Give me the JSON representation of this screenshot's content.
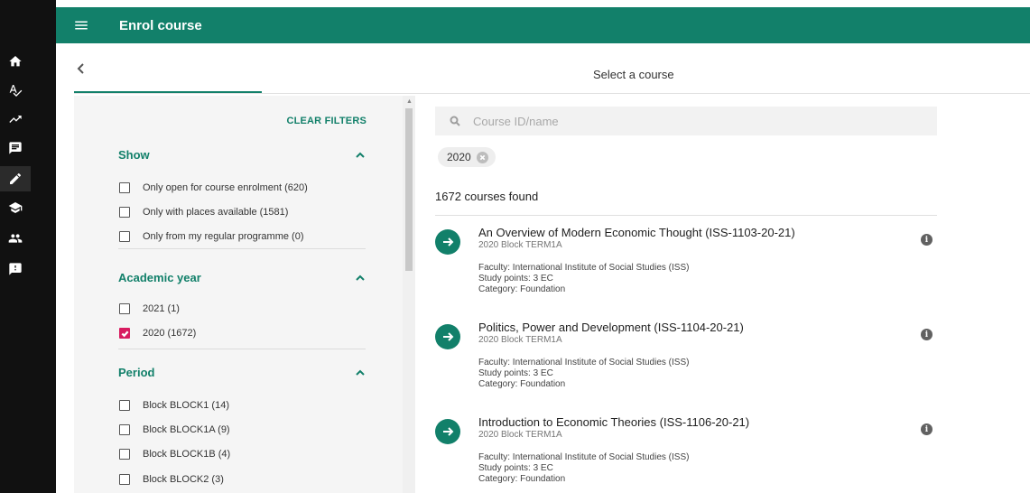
{
  "appbar": {
    "title": "Enrol course",
    "menu_icon": "menu-icon"
  },
  "rail": {
    "items": [
      {
        "icon": "home-icon"
      },
      {
        "icon": "spellcheck-icon"
      },
      {
        "icon": "trending-icon"
      },
      {
        "icon": "message-icon"
      },
      {
        "icon": "edit-icon",
        "active": true
      },
      {
        "icon": "school-icon"
      },
      {
        "icon": "group-icon"
      },
      {
        "icon": "feedback-icon"
      }
    ]
  },
  "subheader": {
    "title": "Select a course"
  },
  "filters": {
    "clear_label": "CLEAR FILTERS",
    "show": {
      "label": "Show",
      "options": [
        {
          "label": "Only open for course enrolment (620)",
          "checked": false
        },
        {
          "label": "Only with places available (1581)",
          "checked": false
        },
        {
          "label": "Only from my regular programme (0)",
          "checked": false
        }
      ]
    },
    "academic_year": {
      "label": "Academic year",
      "options": [
        {
          "label": "2021 (1)",
          "checked": false
        },
        {
          "label": "2020 (1672)",
          "checked": true
        }
      ]
    },
    "period": {
      "label": "Period",
      "options": [
        {
          "label": "Block BLOCK1 (14)",
          "checked": false
        },
        {
          "label": "Block BLOCK1A (9)",
          "checked": false
        },
        {
          "label": "Block BLOCK1B (4)",
          "checked": false
        },
        {
          "label": "Block BLOCK2 (3)",
          "checked": false
        }
      ]
    }
  },
  "search": {
    "placeholder": "Course ID/name",
    "value": ""
  },
  "active_chip": {
    "label": "2020"
  },
  "results_label": "1672 courses found",
  "courses": [
    {
      "title": "An Overview of Modern Economic Thought (ISS-1103-20-21)",
      "subtitle": "2020 Block TERM1A",
      "faculty": "Faculty: International Institute of Social Studies (ISS)",
      "study_points": "Study points: 3 EC",
      "category": "Category: Foundation"
    },
    {
      "title": "Politics, Power and Development (ISS-1104-20-21)",
      "subtitle": "2020 Block TERM1A",
      "faculty": "Faculty: International Institute of Social Studies (ISS)",
      "study_points": "Study points: 3 EC",
      "category": "Category: Foundation"
    },
    {
      "title": "Introduction to Economic Theories (ISS-1106-20-21)",
      "subtitle": "2020 Block TERM1A",
      "faculty": "Faculty: International Institute of Social Studies (ISS)",
      "study_points": "Study points: 3 EC",
      "category": "Category: Foundation"
    }
  ],
  "colors": {
    "brand": "#12806a",
    "checkbox_checked": "#d81b60",
    "rail": "#111111"
  }
}
